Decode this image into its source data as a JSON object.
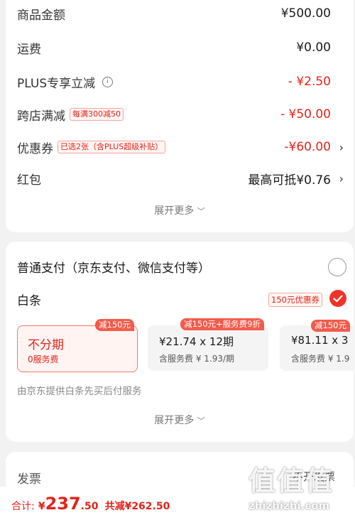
{
  "summary": {
    "rows": [
      {
        "label": "商品金额",
        "value": "¥500.00"
      },
      {
        "label": "运费",
        "value": "¥0.00"
      },
      {
        "label": "PLUS专享立减",
        "value": "- ¥2.50"
      },
      {
        "label": "跨店满减",
        "tag": "每满300减50",
        "value": "- ¥50.00"
      },
      {
        "label": "优惠券",
        "tag": "已选2张（含PLUS超级补贴）",
        "value": "-¥60.00"
      },
      {
        "label": "红包",
        "value": "最高可抵¥0.76"
      }
    ],
    "expand_more": "展开更多"
  },
  "payment": {
    "normal_label": "普通支付（京东支付、微信支付等）",
    "baitiao_label": "白条",
    "coupon_tag": "150元优惠券",
    "options": [
      {
        "badge": "减150元",
        "title": "不分期",
        "sub": "0服务费"
      },
      {
        "badge": "减150元+服务费9折",
        "amount": "¥21.74",
        "period": "x 12期",
        "sub": "含服务费 ¥ 1.93/期"
      },
      {
        "badge": "减150元",
        "amount": "¥81.11",
        "period": "x 3",
        "sub": "含服务费 ¥ 1.9"
      }
    ],
    "provider_note": "由京东提供白条先买后付服务",
    "expand_more": "展开更多"
  },
  "invoice": {
    "label": "发票",
    "value": "不开发票"
  },
  "footer": {
    "total_label": "合计:",
    "currency": "¥",
    "total_int": "237",
    "total_dec": ".50",
    "saved": "共减¥262.50"
  },
  "watermark": {
    "logo": "值值值",
    "site": "zhizhizhi.com"
  },
  "colors": {
    "accent_red": "#e2231a",
    "selected_bg": "#fff4f2"
  }
}
